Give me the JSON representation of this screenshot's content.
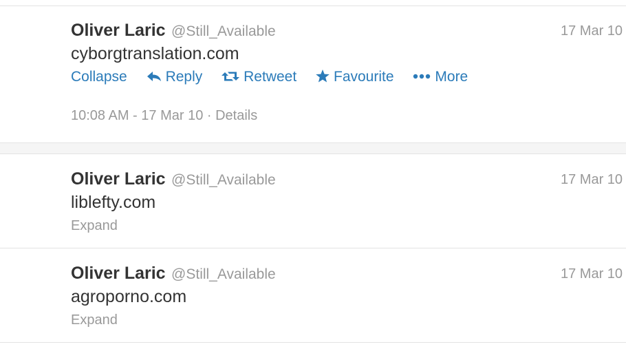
{
  "tweets": [
    {
      "name": "Oliver Laric",
      "handle": "@Still_Available",
      "time": "17 Mar 10",
      "text": "cyborgtranslation.com",
      "actions": {
        "collapse": "Collapse",
        "reply": "Reply",
        "retweet": "Retweet",
        "favourite": "Favourite",
        "more": "More"
      },
      "detail_time": "10:08 AM - 17 Mar 10",
      "detail_sep": " · ",
      "detail_link": "Details"
    },
    {
      "name": "Oliver Laric",
      "handle": "@Still_Available",
      "time": "17 Mar 10",
      "text": "liblefty.com",
      "expand": "Expand"
    },
    {
      "name": "Oliver Laric",
      "handle": "@Still_Available",
      "time": "17 Mar 10",
      "text": "agroporno.com",
      "expand": "Expand"
    }
  ],
  "icons": {
    "reply": "reply-arrow-icon",
    "retweet": "retweet-icon",
    "favourite": "star-icon",
    "more": "ellipsis-icon"
  },
  "colors": {
    "link": "#2b7bb9",
    "name": "#333333",
    "muted": "#999999",
    "divider": "#e3e3e3"
  }
}
